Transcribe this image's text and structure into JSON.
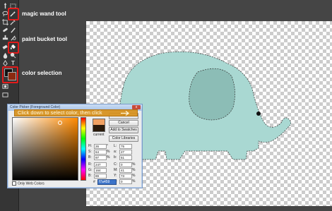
{
  "annotations": {
    "magic_wand": "magic wand tool",
    "paint_bucket": "paint bucket tool",
    "color_selection": "color selection"
  },
  "colors": {
    "highlight": "#e31b1b",
    "elephant": "#a9d8d2",
    "ear": "#8cbdb6",
    "foreground_new": "#f1a162",
    "foreground_current": "#2a1a0a",
    "callout": "#d6901c"
  },
  "toolbar": {
    "icons": [
      "move-icon",
      "marquee-icon",
      "lasso-icon",
      "magic-wand-icon",
      "crop-icon",
      "eyedropper-icon",
      "healing-icon",
      "brush-icon",
      "stamp-icon",
      "history-brush-icon",
      "eraser-icon",
      "paint-bucket-icon",
      "blur-icon",
      "dodge-icon",
      "pen-icon",
      "type-icon",
      "path-select-icon",
      "shape-icon",
      "hand-icon",
      "zoom-icon"
    ]
  },
  "picker": {
    "title": "Color Picker (Foreground Color)",
    "close": "x",
    "ok_label": "OK",
    "cancel_label": "Cancel",
    "add_swatches_label": "Add to Swatches",
    "color_libraries_label": "Color Libraries",
    "current_label": "current",
    "only_web_label": "Only Web Colors",
    "hsb": [
      {
        "label": "H:",
        "value": "26",
        "unit": "°"
      },
      {
        "label": "S:",
        "value": "64",
        "unit": "%"
      },
      {
        "label": "B:",
        "value": "97",
        "unit": "%"
      }
    ],
    "rgb": [
      {
        "label": "R:",
        "value": "247"
      },
      {
        "label": "G:",
        "value": "164"
      },
      {
        "label": "B:",
        "value": "89"
      }
    ],
    "lab": [
      {
        "label": "L:",
        "value": "75"
      },
      {
        "label": "a:",
        "value": "27"
      },
      {
        "label": "b:",
        "value": "51"
      }
    ],
    "cmyk": [
      {
        "label": "C:",
        "value": "0",
        "unit": "%"
      },
      {
        "label": "M:",
        "value": "41",
        "unit": "%"
      },
      {
        "label": "Y:",
        "value": "73",
        "unit": "%"
      },
      {
        "label": "K:",
        "value": "0",
        "unit": "%"
      }
    ],
    "hex_label": "#",
    "hex_value": "f7a459"
  },
  "callout": {
    "text": "Click down to select color, then click"
  }
}
